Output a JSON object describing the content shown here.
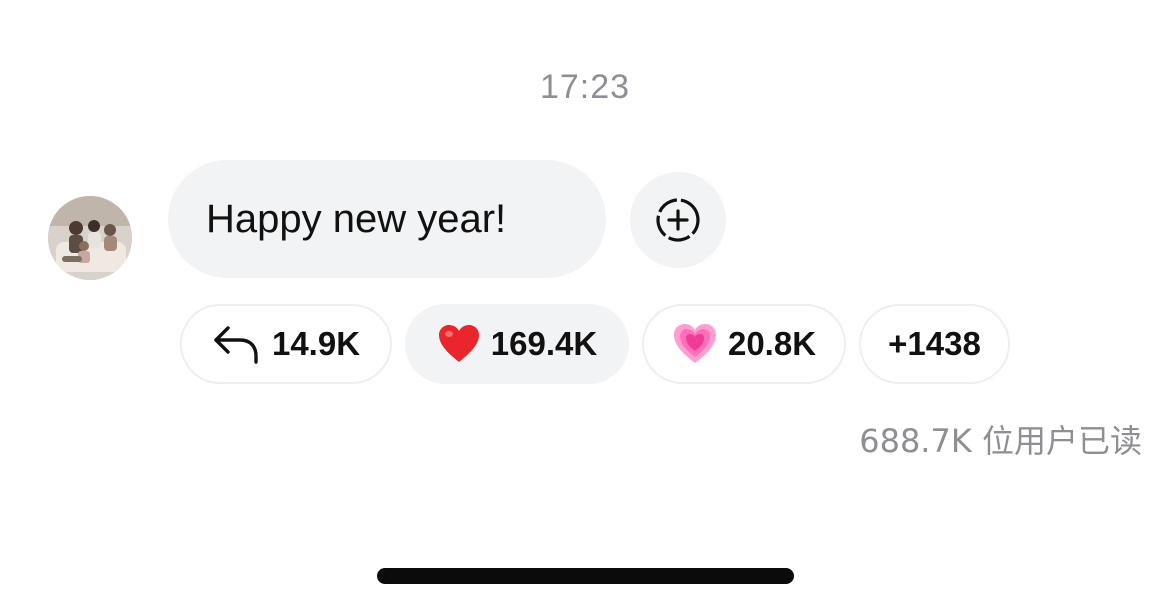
{
  "chat": {
    "timestamp": "17:23",
    "message": {
      "text": "Happy new year!"
    },
    "reactions": [
      {
        "icon": "reply-arrow-icon",
        "count": "14.9K"
      },
      {
        "icon": "red-heart-icon",
        "count": "169.4K",
        "selected": true
      },
      {
        "icon": "growing-heart-icon",
        "count": "20.8K"
      },
      {
        "count": "+1438"
      }
    ],
    "seen_text": "688.7K 位用户已读"
  },
  "colors": {
    "bubble": "#f2f3f5",
    "muted_text": "#8e8e93",
    "text": "#111111"
  }
}
